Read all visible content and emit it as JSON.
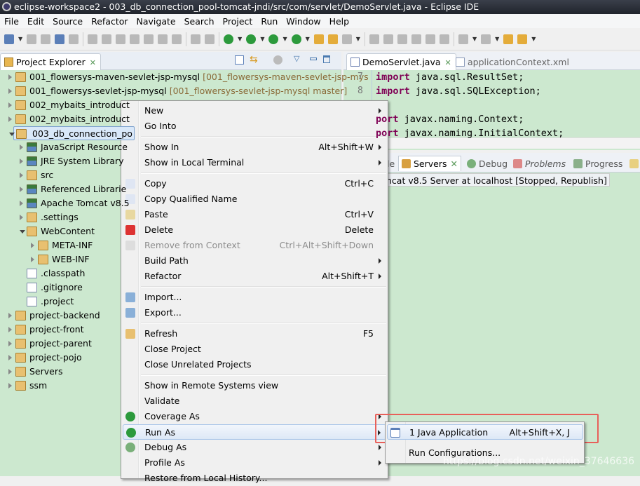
{
  "window": {
    "title": "eclipse-workspace2 - 003_db_connection_pool-tomcat-jndi/src/com/servlet/DemoServlet.java - Eclipse IDE"
  },
  "menubar": [
    "File",
    "Edit",
    "Source",
    "Refactor",
    "Navigate",
    "Search",
    "Project",
    "Run",
    "Window",
    "Help"
  ],
  "project_explorer": {
    "tab": "Project Explorer",
    "items": [
      {
        "label": "001_flowersys-maven-sevlet-jsp-mysql",
        "decoration": "[001_flowersys-maven-sevlet-jsp-mys",
        "level": 0,
        "open": false
      },
      {
        "label": "001_flowersys-sevlet-jsp-mysql",
        "decoration": "[001_flowersys-sevlet-jsp-mysql master]",
        "level": 0,
        "open": false
      },
      {
        "label": "002_mybaits_introduct",
        "level": 0,
        "open": false
      },
      {
        "label": "002_mybaits_introduct",
        "level": 0,
        "open": false
      },
      {
        "label": "003_db_connection_po",
        "level": 0,
        "open": true,
        "selected": true
      },
      {
        "label": "JavaScript Resource",
        "level": 1,
        "icon": "library",
        "open": false
      },
      {
        "label": "JRE System Library",
        "level": 1,
        "icon": "library",
        "open": false
      },
      {
        "label": "src",
        "level": 1,
        "icon": "package-folder",
        "open": false
      },
      {
        "label": "Referenced Librarie",
        "level": 1,
        "icon": "library",
        "open": false
      },
      {
        "label": "Apache Tomcat v8.5",
        "level": 1,
        "icon": "library",
        "open": false
      },
      {
        "label": ".settings",
        "level": 1,
        "icon": "folder",
        "open": false
      },
      {
        "label": "WebContent",
        "level": 1,
        "icon": "folder",
        "open": true
      },
      {
        "label": "META-INF",
        "level": 2,
        "icon": "folder",
        "open": false
      },
      {
        "label": "WEB-INF",
        "level": 2,
        "icon": "folder",
        "open": false
      },
      {
        "label": ".classpath",
        "level": 1,
        "icon": "xml-file"
      },
      {
        "label": ".gitignore",
        "level": 1,
        "icon": "text-file"
      },
      {
        "label": ".project",
        "level": 1,
        "icon": "xml-file"
      },
      {
        "label": "project-backend",
        "level": 0,
        "open": false
      },
      {
        "label": "project-front",
        "level": 0,
        "open": false
      },
      {
        "label": "project-parent",
        "level": 0,
        "open": false
      },
      {
        "label": "project-pojo",
        "level": 0,
        "open": false
      },
      {
        "label": "Servers",
        "level": 0,
        "open": false
      },
      {
        "label": "ssm",
        "level": 0,
        "open": false
      }
    ]
  },
  "editor": {
    "tabs": [
      "DemoServlet.java",
      "applicationContext.xml"
    ],
    "lines": [
      {
        "num": "7",
        "kw": "import",
        "rest": " java.sql.ResultSet;"
      },
      {
        "num": "8",
        "kw": "import",
        "rest": " java.sql.SQLException;"
      },
      {
        "num": "",
        "kw": "",
        "rest": ""
      },
      {
        "num": "",
        "kw": "port",
        "rest": " javax.naming.Context;"
      },
      {
        "num": "",
        "kw": "port",
        "rest": " javax.naming.InitialContext;"
      }
    ]
  },
  "bottom_panel": {
    "tabs": [
      "le",
      "Servers",
      "Debug",
      "Problems",
      "Progress"
    ],
    "server_row": "ncat v8.5 Server at localhost  [Stopped, Republish]"
  },
  "context_menu": [
    {
      "label": "New",
      "sub": true
    },
    {
      "label": "Go Into"
    },
    {
      "sep": true
    },
    {
      "label": "Show In",
      "shortcut": "Alt+Shift+W",
      "sub": true
    },
    {
      "label": "Show in Local Terminal",
      "sub": true
    },
    {
      "sep": true
    },
    {
      "label": "Copy",
      "shortcut": "Ctrl+C",
      "icon": "copy"
    },
    {
      "label": "Copy Qualified Name",
      "icon": "copy-qualified"
    },
    {
      "label": "Paste",
      "shortcut": "Ctrl+V",
      "icon": "paste"
    },
    {
      "label": "Delete",
      "shortcut": "Delete",
      "icon": "delete"
    },
    {
      "label": "Remove from Context",
      "shortcut": "Ctrl+Alt+Shift+Down",
      "disabled": true,
      "icon": "remove-context"
    },
    {
      "label": "Build Path",
      "sub": true
    },
    {
      "label": "Refactor",
      "shortcut": "Alt+Shift+T",
      "sub": true
    },
    {
      "sep": true
    },
    {
      "label": "Import...",
      "icon": "import"
    },
    {
      "label": "Export...",
      "icon": "export"
    },
    {
      "sep": true
    },
    {
      "label": "Refresh",
      "shortcut": "F5",
      "icon": "refresh"
    },
    {
      "label": "Close Project"
    },
    {
      "label": "Close Unrelated Projects"
    },
    {
      "sep": true
    },
    {
      "label": "Show in Remote Systems view"
    },
    {
      "label": "Validate"
    },
    {
      "label": "Coverage As",
      "sub": true,
      "icon": "coverage"
    },
    {
      "label": "Run As",
      "sub": true,
      "icon": "run",
      "hover": true
    },
    {
      "label": "Debug As",
      "sub": true,
      "icon": "debug"
    },
    {
      "label": "Profile As",
      "sub": true
    },
    {
      "label": "Restore from Local History..."
    }
  ],
  "run_as_submenu": [
    {
      "label": "1 Java Application",
      "shortcut": "Alt+Shift+X, J",
      "highlighted": true
    },
    {
      "label": "Run Configurations..."
    }
  ],
  "watermark": "https://blog.csdn.net/weixin_37646636",
  "colors": {
    "tree_background": "#cce8cf",
    "keyword": "#7f0055",
    "annotation_box": "#e8605a"
  }
}
